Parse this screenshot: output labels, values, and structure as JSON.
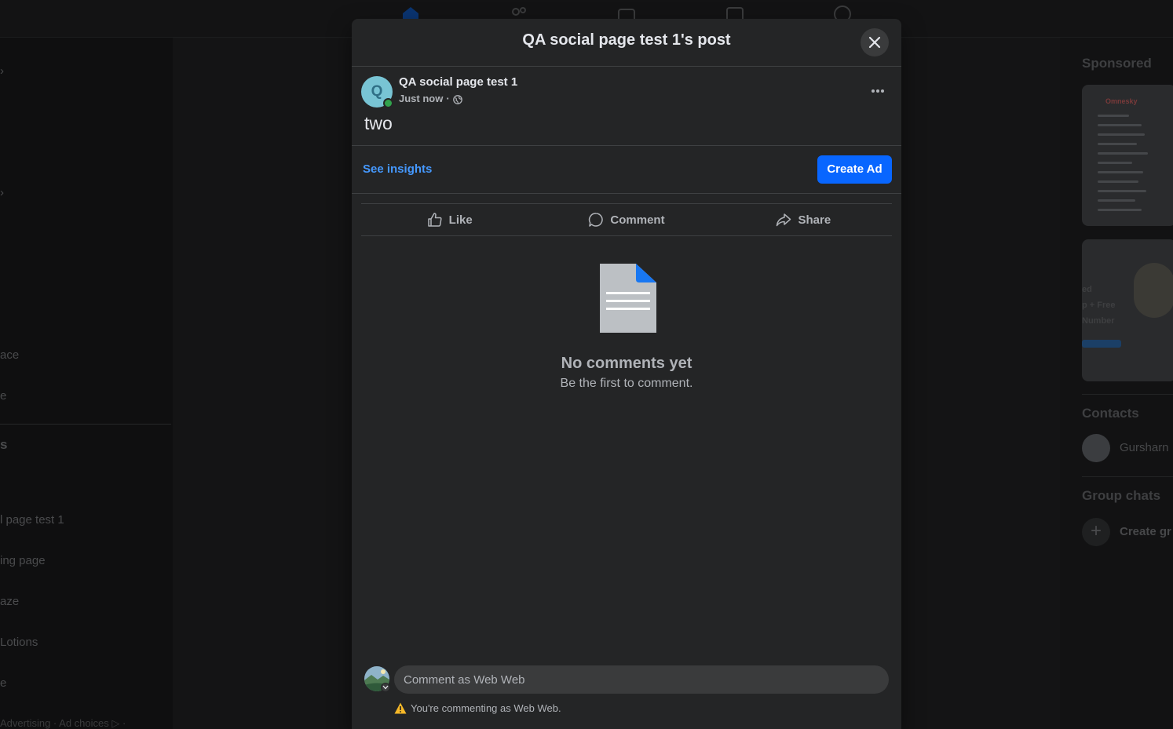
{
  "background": {
    "left_items": [
      "ace",
      "e",
      "s",
      "l page test 1",
      "ing page",
      "aze",
      "Lotions",
      "e"
    ],
    "footer": "Advertising · Ad choices ▷ ·",
    "right": {
      "sponsored_heading": "Sponsored",
      "ad1_brand": "Omnesky",
      "ad2_lines": [
        "ed",
        "p + Free",
        "Number"
      ],
      "contacts_heading": "Contacts",
      "contact_name": "Gursharn",
      "group_chats_heading": "Group chats",
      "create_group_label": "Create gr"
    }
  },
  "modal": {
    "title": "QA social page test 1's post",
    "post": {
      "avatar_letter": "Q",
      "author": "QA social page test 1",
      "time": "Just now",
      "separator": "·",
      "text": "two"
    },
    "insights": {
      "see_insights_label": "See insights",
      "create_ad_label": "Create Ad"
    },
    "actions": {
      "like": "Like",
      "comment": "Comment",
      "share": "Share"
    },
    "empty": {
      "title": "No comments yet",
      "subtitle": "Be the first to comment."
    },
    "composer": {
      "placeholder": "Comment as Web Web",
      "warning": "You're commenting as Web Web."
    }
  },
  "colors": {
    "accent": "#0866ff",
    "link": "#4599ff",
    "online": "#31a24c",
    "warning": "#f7b928"
  }
}
